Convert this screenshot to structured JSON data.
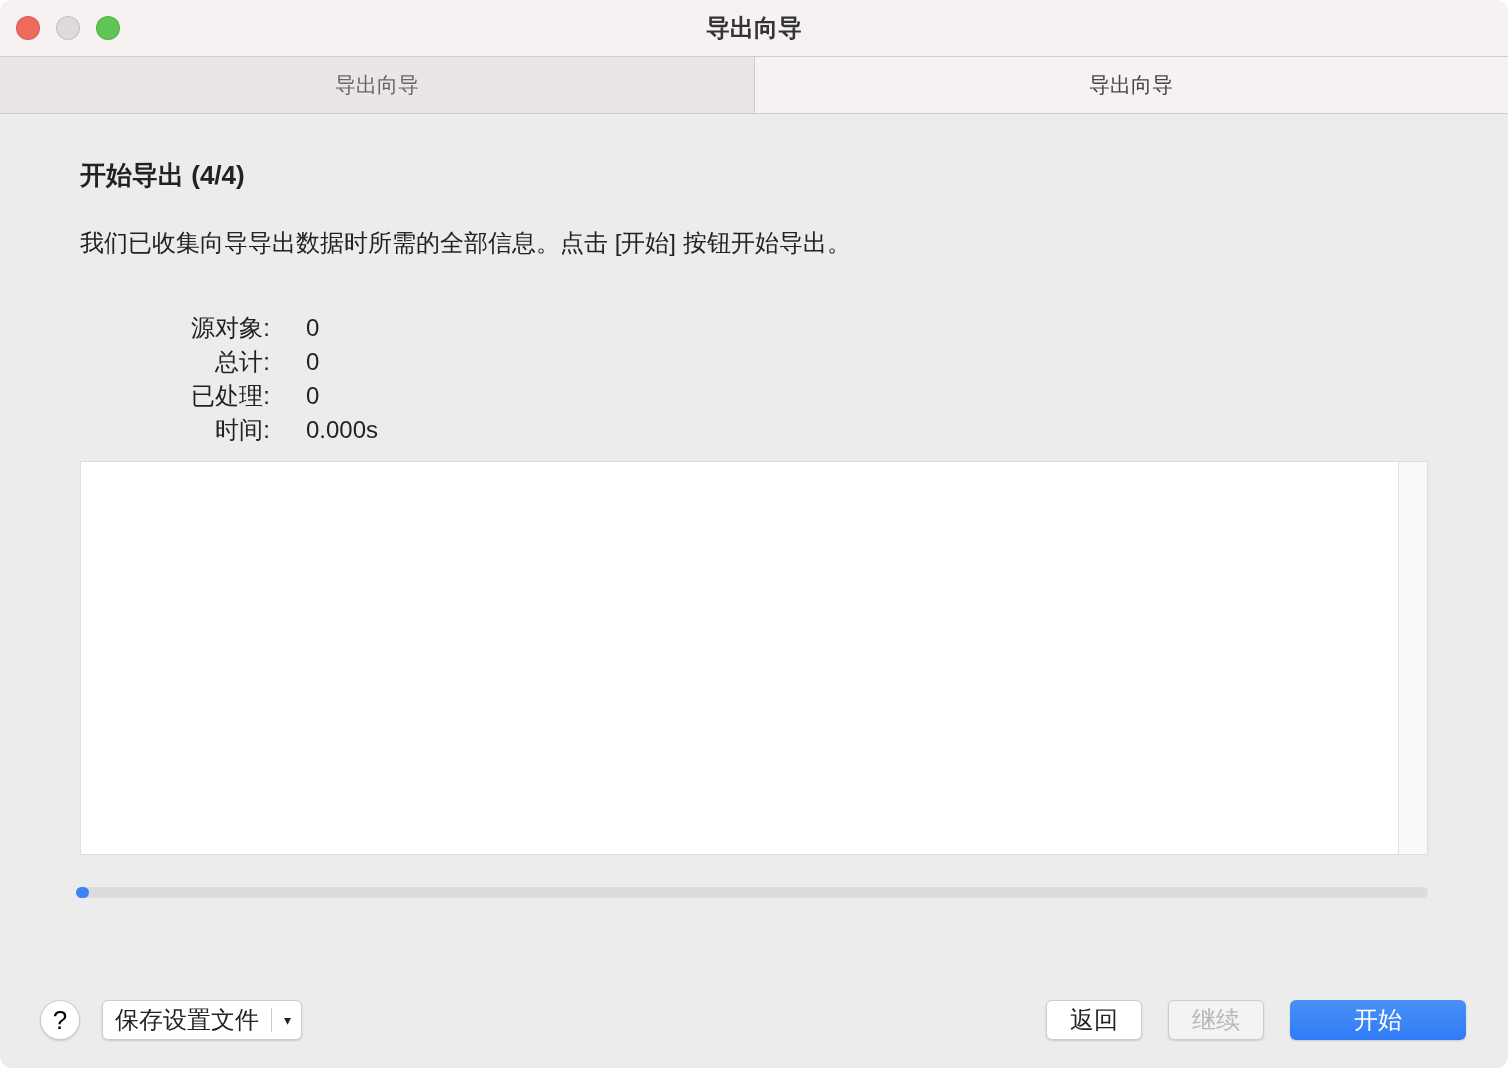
{
  "window": {
    "title": "导出向导"
  },
  "tabs": [
    {
      "label": "导出向导",
      "selected": false
    },
    {
      "label": "导出向导",
      "selected": true
    }
  ],
  "heading": "开始导出 (4/4)",
  "description": "我们已收集向导导出数据时所需的全部信息。点击 [开始] 按钮开始导出。",
  "stats": [
    {
      "label": "源对象:",
      "value": "0"
    },
    {
      "label": "总计:",
      "value": "0"
    },
    {
      "label": "已处理:",
      "value": "0"
    },
    {
      "label": "时间:",
      "value": "0.000s"
    }
  ],
  "progress": {
    "level": 0
  },
  "footer": {
    "help": "?",
    "profile": {
      "label": "保存设置文件",
      "caret": "▾"
    },
    "buttons": [
      {
        "label": "返回",
        "kind": "normal",
        "disabled": false
      },
      {
        "label": "继续",
        "kind": "normal",
        "disabled": true
      },
      {
        "label": "开始",
        "kind": "primary",
        "disabled": false
      }
    ]
  }
}
